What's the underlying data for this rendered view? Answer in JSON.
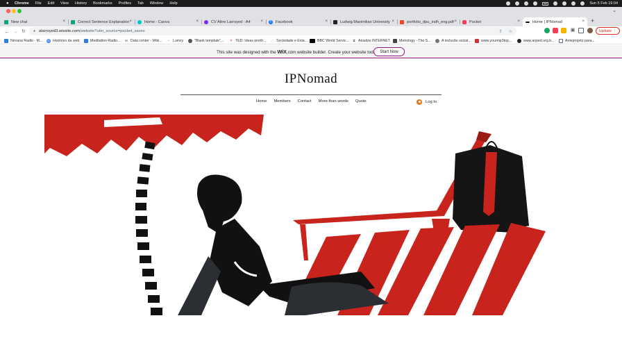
{
  "menubar": {
    "app": "Chrome",
    "items": [
      "File",
      "Edit",
      "View",
      "History",
      "Bookmarks",
      "Profiles",
      "Tab",
      "Window",
      "Help"
    ],
    "datetime": "Sun 5 Feb  19:04"
  },
  "tabs": [
    {
      "label": "New chat",
      "fav_color": "#10a37f"
    },
    {
      "label": "Correct Sentence Explanation",
      "fav_color": "#10a37f"
    },
    {
      "label": "Home - Canva",
      "fav_color": "#00c4cc"
    },
    {
      "label": "CV Aline Larroyed - A4",
      "fav_color": "#7d2ae8"
    },
    {
      "label": "Facebook",
      "fav_color": "#1877f2"
    },
    {
      "label": "Ludwig Maximilian University",
      "fav_color": "#222222"
    },
    {
      "label": "portfolio_dpu_indh_eng.pdf",
      "fav_color": "#e8472b"
    },
    {
      "label": "Pocket",
      "fav_color": "#ef4056"
    },
    {
      "label": "Home | IPNomad",
      "fav_color": "#111111"
    }
  ],
  "address": {
    "domain": "alarroyed3.wixsite.com",
    "path": "/website?utm_source=pocket_saves"
  },
  "update_label": "Update",
  "bookmarks": [
    {
      "label": "Nirvana Radio - M...",
      "color": "#2a7de1"
    },
    {
      "label": "Histórico da web",
      "color": "#4285f4"
    },
    {
      "label": "Meditation Radio...",
      "color": "#2a7de1"
    },
    {
      "label": "Data center - Wiki...",
      "color": "#555555"
    },
    {
      "label": "Lumzy",
      "color": "#888888"
    },
    {
      "label": "\"Blank template\"...",
      "color": "#555555"
    },
    {
      "label": "TED: Ideas worth...",
      "color": "#e62b1e"
    },
    {
      "label": "Sociedade e Esta...",
      "color": "#999999"
    },
    {
      "label": "BBC World Servic...",
      "color": "#000000"
    },
    {
      "label": "Atualize INTERNET",
      "color": "#1a1a1a"
    },
    {
      "label": "Metrology - The S...",
      "color": "#444444"
    },
    {
      "label": "A inclusão social...",
      "color": "#777777"
    },
    {
      "label": "www.yourmp3top...",
      "color": "#cc3333"
    },
    {
      "label": "www.anped.org.b...",
      "color": "#222222"
    },
    {
      "label": "Anteprojeto para...",
      "color": "#5b6b8a"
    }
  ],
  "wix": {
    "text_before": "This site was designed with the ",
    "logo": "WiX",
    "text_after": ".com website builder. Create your website today.",
    "button": "Start Now"
  },
  "site": {
    "title": "IPNomad",
    "nav": [
      "Home",
      "Members",
      "Contact",
      "More than words",
      "Quote"
    ],
    "login": "Log In"
  }
}
